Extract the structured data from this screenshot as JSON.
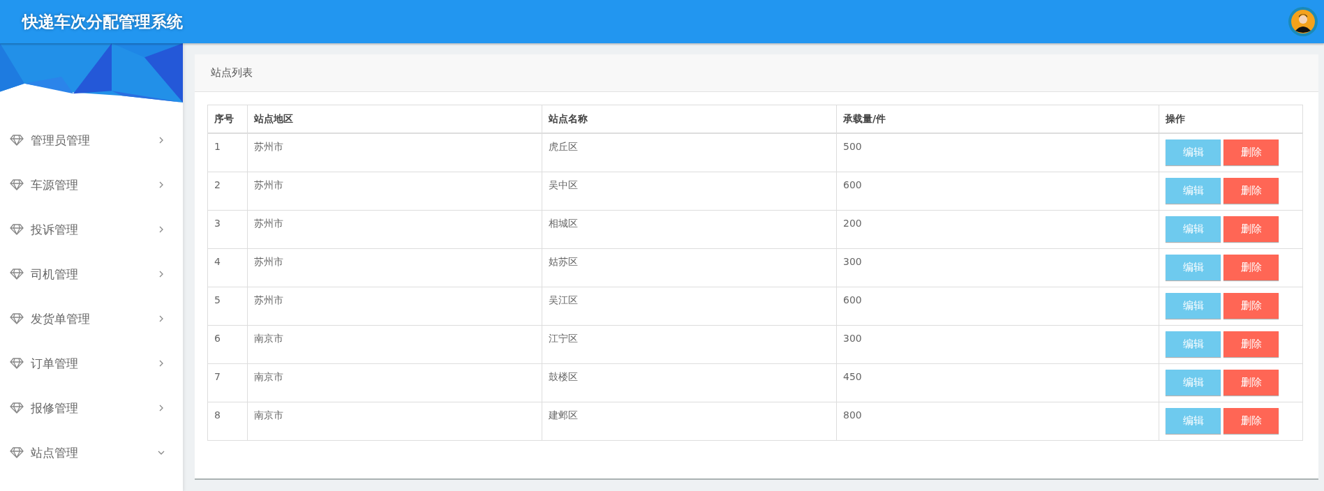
{
  "header": {
    "title": "快递车次分配管理系统"
  },
  "sidebar": {
    "items": [
      {
        "label": "管理员管理",
        "expanded": false
      },
      {
        "label": "车源管理",
        "expanded": false
      },
      {
        "label": "投诉管理",
        "expanded": false
      },
      {
        "label": "司机管理",
        "expanded": false
      },
      {
        "label": "发货单管理",
        "expanded": false
      },
      {
        "label": "订单管理",
        "expanded": false
      },
      {
        "label": "报修管理",
        "expanded": false
      },
      {
        "label": "站点管理",
        "expanded": true
      }
    ]
  },
  "panel": {
    "title": "站点列表"
  },
  "table": {
    "columns": [
      "序号",
      "站点地区",
      "站点名称",
      "承载量/件",
      "操作"
    ],
    "rows": [
      {
        "cells": [
          "1",
          "苏州市",
          "虎丘区",
          "500"
        ],
        "actions": [
          "编辑",
          "删除"
        ]
      },
      {
        "cells": [
          "2",
          "苏州市",
          "吴中区",
          "600"
        ],
        "actions": [
          "编辑",
          "删除"
        ]
      },
      {
        "cells": [
          "3",
          "苏州市",
          "相城区",
          "200"
        ],
        "actions": [
          "编辑",
          "删除"
        ]
      },
      {
        "cells": [
          "4",
          "苏州市",
          "姑苏区",
          "300"
        ],
        "actions": [
          "编辑",
          "删除"
        ]
      },
      {
        "cells": [
          "5",
          "苏州市",
          "吴江区",
          "600"
        ],
        "actions": [
          "编辑",
          "删除"
        ]
      },
      {
        "cells": [
          "6",
          "南京市",
          "江宁区",
          "300"
        ],
        "actions": [
          "编辑",
          "删除"
        ]
      },
      {
        "cells": [
          "7",
          "南京市",
          "鼓楼区",
          "450"
        ],
        "actions": [
          "编辑",
          "删除"
        ]
      },
      {
        "cells": [
          "8",
          "南京市",
          "建邺区",
          "800"
        ],
        "actions": [
          "编辑",
          "删除"
        ]
      }
    ]
  }
}
